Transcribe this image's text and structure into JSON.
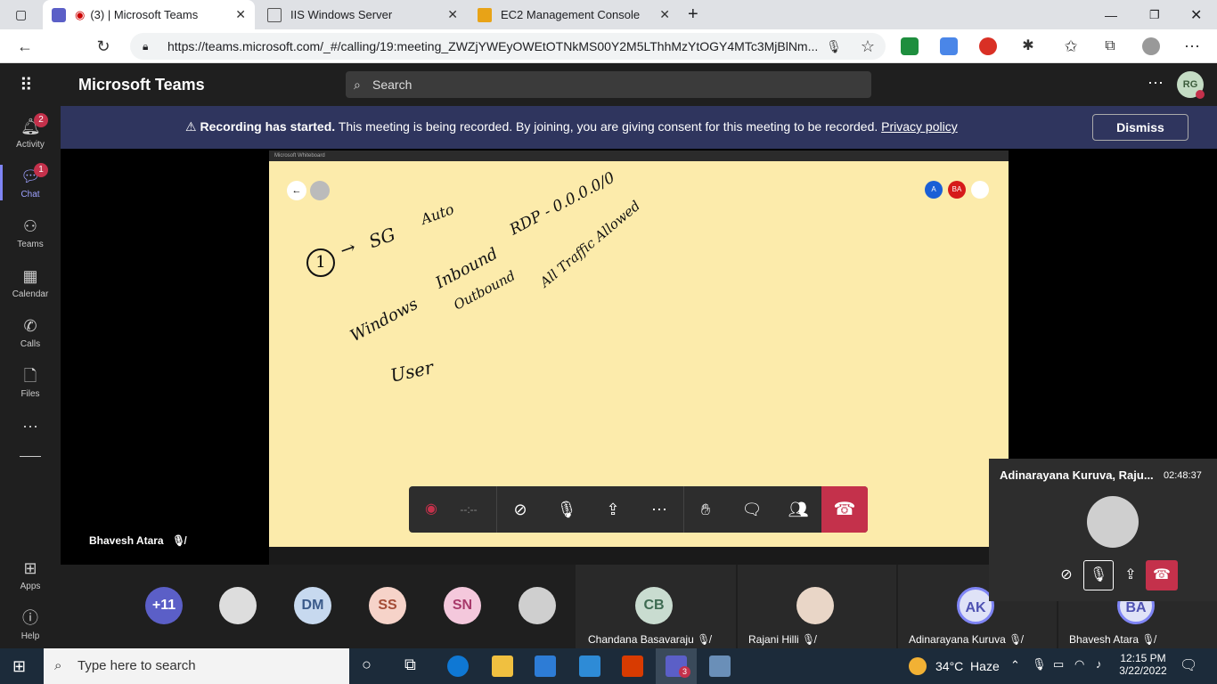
{
  "browser": {
    "tabs": [
      {
        "title": "(3) | Microsoft Teams",
        "active": true
      },
      {
        "title": "IIS Windows Server",
        "active": false
      },
      {
        "title": "EC2 Management Console",
        "active": false
      }
    ],
    "url": "https://teams.microsoft.com/_#/calling/19:meeting_ZWZjYWEyOWEtOTNkMS00Y2M5LThhMzYtOGY4MTc3MjBlNm..."
  },
  "teams": {
    "app_name": "Microsoft Teams",
    "search_placeholder": "Search",
    "user_initials": "RG"
  },
  "banner": {
    "bold": "Recording has started.",
    "text": "This meeting is being recorded. By joining, you are giving consent for this meeting to be recorded.",
    "link": "Privacy policy",
    "dismiss": "Dismiss"
  },
  "rail": [
    {
      "label": "Activity",
      "badge": "2"
    },
    {
      "label": "Chat",
      "badge": "1"
    },
    {
      "label": "Teams",
      "badge": ""
    },
    {
      "label": "Calendar",
      "badge": ""
    },
    {
      "label": "Calls",
      "badge": ""
    },
    {
      "label": "Files",
      "badge": ""
    },
    {
      "label": "Apps",
      "badge": ""
    },
    {
      "label": "Help",
      "badge": ""
    }
  ],
  "whiteboard": {
    "title": "Microsoft Whiteboard",
    "avatars": [
      "A",
      "BA"
    ],
    "notes": [
      "1",
      "SG",
      "Auto",
      "Windows",
      "Inbound",
      "RDP - 0.0.0.0/0",
      "Outbound",
      "All Traffic Allowed",
      "User"
    ]
  },
  "stage": {
    "presenter": "Bhavesh Atara"
  },
  "controls": {
    "timer": "--:--"
  },
  "participants": {
    "overflow": "+11",
    "avatars": [
      "DM",
      "SS",
      "SN"
    ],
    "tiles": [
      {
        "initials": "CB",
        "name": "Chandana Basavaraju"
      },
      {
        "initials": "",
        "name": "Rajani Hilli"
      },
      {
        "initials": "AK",
        "name": "Adinarayana Kuruva"
      },
      {
        "initials": "BA",
        "name": "Bhavesh Atara"
      }
    ]
  },
  "mini_window": {
    "title": "Adinarayana Kuruva, Raju...",
    "timer": "02:48:37"
  },
  "taskbar": {
    "search": "Type here to search",
    "weather": "34°C  Haze",
    "time": "12:15 PM",
    "date": "3/22/2022",
    "teams_badge": "3"
  },
  "colors": {
    "banner": "#2f355e",
    "hangup": "#c4314b",
    "whiteboard": "#fcebab",
    "accent": "#6264a7"
  }
}
